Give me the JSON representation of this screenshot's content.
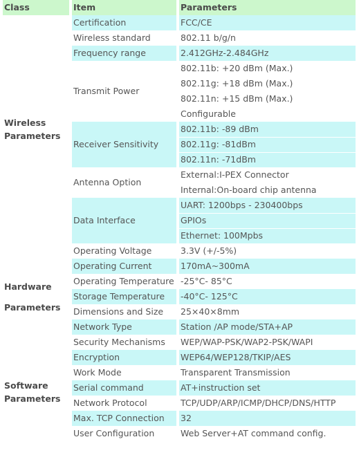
{
  "header": {
    "class": "Class",
    "item": "Item",
    "parameters": "Parameters"
  },
  "colors": {
    "header_bg": "#ccf7cc",
    "highlight_bg": "#c9f7f7",
    "accent_bar": "#33c4c4"
  },
  "groups": [
    {
      "class": "Wireless Parameters"
    },
    {
      "class": "Hardware Parameters"
    },
    {
      "class": "Software Parameters"
    }
  ],
  "rows": [
    {
      "item": "Certification",
      "values": [
        "FCC/CE"
      ],
      "hl": true
    },
    {
      "item": "Wireless standard",
      "values": [
        "802.11 b/g/n"
      ],
      "hl": false
    },
    {
      "item": "Frequency range",
      "values": [
        "2.412GHz-2.484GHz"
      ],
      "hl": true
    },
    {
      "item": "Transmit Power",
      "values": [
        "802.11b: +20 dBm (Max.)",
        "802.11g: +18 dBm (Max.)",
        "802.11n: +15 dBm (Max.)",
        "Configurable"
      ],
      "hl": false
    },
    {
      "item": "Receiver Sensitivity",
      "values": [
        "802.11b: -89 dBm",
        "802.11g: -81dBm",
        "802.11n: -71dBm"
      ],
      "hl": true
    },
    {
      "item": "Antenna Option",
      "values": [
        "External:I-PEX Connector",
        "Internal:On-board chip antenna"
      ],
      "hl": false
    },
    {
      "item": "Data Interface",
      "values": [
        "UART: 1200bps - 230400bps",
        "GPIOs",
        "Ethernet: 100Mpbs"
      ],
      "hl": true
    },
    {
      "item": "Operating Voltage",
      "values": [
        "3.3V (+/-5%)"
      ],
      "hl": false
    },
    {
      "item": "Operating Current",
      "values": [
        "170mA~300mA"
      ],
      "hl": true
    },
    {
      "item": "Operating Temperature",
      "values": [
        "-25°C- 85°C"
      ],
      "hl": false
    },
    {
      "item": "Storage Temperature",
      "values": [
        "-40°C- 125°C"
      ],
      "hl": true
    },
    {
      "item": "Dimensions and Size",
      "values": [
        "25×40×8mm"
      ],
      "hl": false
    },
    {
      "item": "Network Type",
      "values": [
        "Station /AP mode/STA+AP"
      ],
      "hl": true
    },
    {
      "item": "Security Mechanisms",
      "values": [
        "WEP/WAP-PSK/WAP2-PSK/WAPI"
      ],
      "hl": false
    },
    {
      "item": "Encryption",
      "values": [
        "WEP64/WEP128/TKIP/AES"
      ],
      "hl": true
    },
    {
      "item": "Work Mode",
      "values": [
        "Transparent Transmission"
      ],
      "hl": false
    },
    {
      "item": "Serial command",
      "values": [
        "AT+instruction set"
      ],
      "hl": true
    },
    {
      "item": "Network Protocol",
      "values": [
        "TCP/UDP/ARP/ICMP/DHCP/DNS/HTTP"
      ],
      "hl": false
    },
    {
      "item": "Max. TCP Connection",
      "values": [
        "32"
      ],
      "hl": true
    },
    {
      "item": "User Configuration",
      "values": [
        "Web Server+AT command config."
      ],
      "hl": false
    }
  ]
}
